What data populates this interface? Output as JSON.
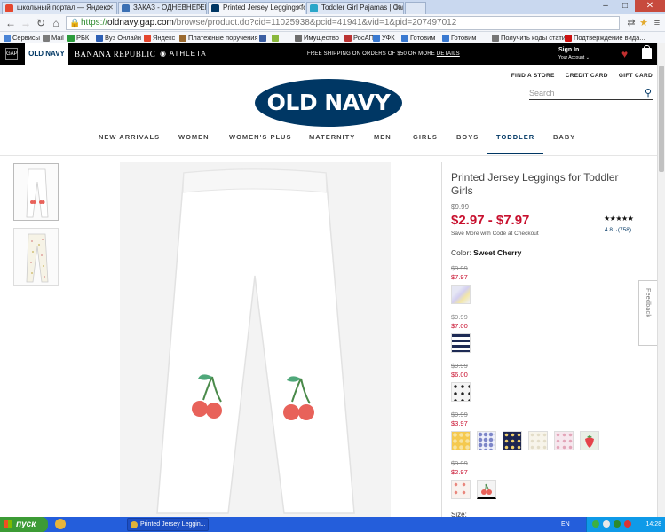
{
  "browser": {
    "tabs": [
      {
        "title": "школьный портал — Яндекс",
        "fav_color": "#e5472f"
      },
      {
        "title": "ЗАКАЗ - ОДНЕВНЕГЕП СП",
        "fav_color": "#3a6fb3"
      },
      {
        "title": "Printed Jersey Leggings for T",
        "fav_color": "#003764"
      },
      {
        "title": "Toddler Girl Pajamas | Carter",
        "fav_color": "#2aa6c9"
      }
    ],
    "url_scheme": "https://",
    "url_domain": "oldnavy.gap.com",
    "url_path": "/browse/product.do?cid=11025938&pcid=41941&vid=1&pid=207497012",
    "bookmarks": [
      {
        "label": "Сервисы",
        "color": "#4a84d6"
      },
      {
        "label": "Mail",
        "color": "#7b7b7b"
      },
      {
        "label": "РБК",
        "color": "#2b9b3b"
      },
      {
        "label": "Вуз Онлайн",
        "color": "#2d5fb4"
      },
      {
        "label": "Яндекс",
        "color": "#e4452d"
      },
      {
        "label": "Платежные поручения",
        "color": "#9a6a30"
      },
      {
        "label": "",
        "color": "#3c5fa3"
      },
      {
        "label": "",
        "color": "#8ab83d"
      },
      {
        "label": "Имущество",
        "color": "#6e6e6e"
      },
      {
        "label": "РосАПК",
        "color": "#b33"
      },
      {
        "label": "УФК",
        "color": "#3a7ad1"
      },
      {
        "label": "Готовим",
        "color": "#3a7ad1"
      },
      {
        "label": "Готовим",
        "color": "#3a7ad1"
      },
      {
        "label": "Получить коды статис",
        "color": "#777"
      },
      {
        "label": "Подтверждение вида...",
        "color": "#c11"
      }
    ]
  },
  "brandbar": {
    "gap": "GAP",
    "oldnavy": "OLD NAVY",
    "banana": "BANANA REPUBLIC",
    "athleta": "ATHLETA",
    "shipping": "FREE SHIPPING ON ORDERS OF $50 OR MORE",
    "details": "DETAILS",
    "signin": "Sign In",
    "account": "Your Account"
  },
  "utility": {
    "store": "FIND A STORE",
    "credit": "CREDIT CARD",
    "gift": "GIFT CARD"
  },
  "search_placeholder": "Search",
  "logo": "OLD NAVY",
  "categories": [
    "NEW ARRIVALS",
    "WOMEN",
    "WOMEN'S PLUS",
    "MATERNITY",
    "MEN",
    "GIRLS",
    "BOYS",
    "TODDLER",
    "BABY"
  ],
  "active_category": "TODDLER",
  "product": {
    "title": "Printed Jersey Leggings for Toddler Girls",
    "was": "$9.99",
    "price": "$2.97 - $7.97",
    "promo": "Save More with Code at Checkout",
    "stars": "★★★★★",
    "rating": "4.8",
    "reviews": "(758)",
    "color_label": "Color:",
    "color_value": "Sweet Cherry",
    "size_label": "Size:"
  },
  "price_groups": [
    {
      "old": "$9.99",
      "new": "$7.97"
    },
    {
      "old": "$9.99",
      "new": "$7.00"
    },
    {
      "old": "$9.99",
      "new": "$6.00"
    },
    {
      "old": "$9.99",
      "new": "$3.97"
    },
    {
      "old": "$9.99",
      "new": "$2.97"
    }
  ],
  "feedback": "Feedback",
  "taskbar": {
    "start": "пуск",
    "task": "Printed Jersey Leggin...",
    "lang": "EN",
    "clock": "14:28"
  }
}
